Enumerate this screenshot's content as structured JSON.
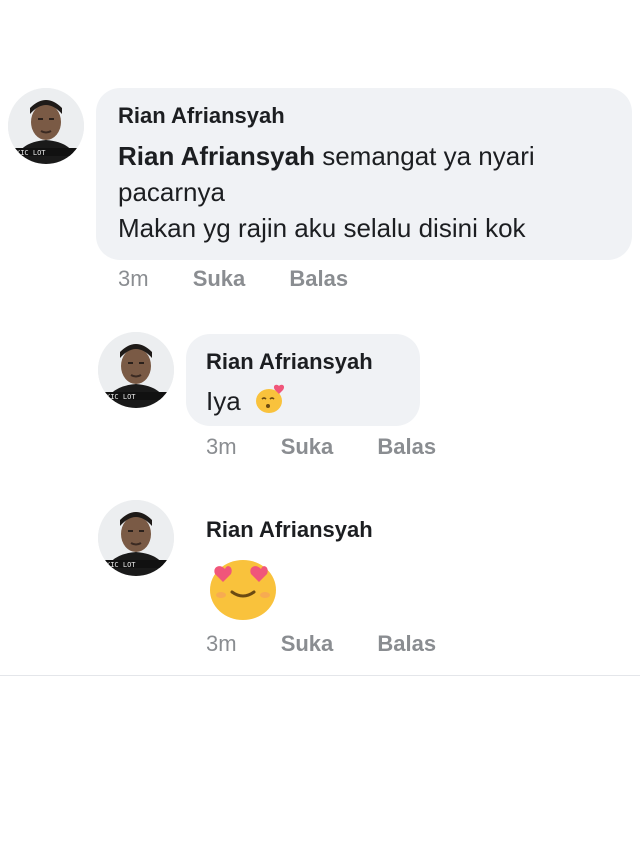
{
  "comments": [
    {
      "author": "Rian Afriansyah",
      "mention": "Rian Afriansyah",
      "text_line1": " semangat ya nyari",
      "text_line2": "pacarnya",
      "text_line3": "Makan yg rajin aku selalu disini kok",
      "time": "3m",
      "like_label": "Suka",
      "reply_label": "Balas",
      "avatar_icon": "profile-photo"
    },
    {
      "author": "Rian Afriansyah",
      "text": "Iya",
      "emoji_icon": "kissing-heart-emoji-icon",
      "time": "3m",
      "like_label": "Suka",
      "reply_label": "Balas",
      "avatar_icon": "profile-photo"
    },
    {
      "author": "Rian Afriansyah",
      "emoji_icon": "heart-eyes-emoji-icon",
      "time": "3m",
      "like_label": "Suka",
      "reply_label": "Balas",
      "avatar_icon": "profile-photo"
    }
  ],
  "colors": {
    "bubble": "#f0f2f5",
    "meta_text": "#8a8d91",
    "emoji_yellow": "#f9c23c",
    "emoji_heart": "#f0567a"
  }
}
